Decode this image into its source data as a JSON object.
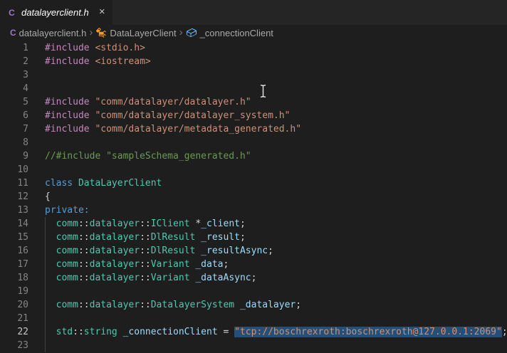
{
  "tab_bar": {
    "tabs": [
      {
        "icon": "c-file",
        "icon_letter": "C",
        "label": "datalayerclient.h",
        "close": "✕",
        "active": true,
        "preview": true
      }
    ]
  },
  "breadcrumb": {
    "separator": "›",
    "items": [
      {
        "icon": "c-file",
        "icon_letter": "C",
        "label": "datalayerclient.h"
      },
      {
        "icon": "symbol-class",
        "label": "DataLayerClient"
      },
      {
        "icon": "symbol-field",
        "label": "_connectionClient"
      }
    ]
  },
  "editor": {
    "language": "cpp",
    "active_line": 22,
    "lines": [
      {
        "num": "1",
        "tokens": [
          {
            "c": "macro",
            "t": "#include"
          },
          {
            "c": "pln",
            "t": " "
          },
          {
            "c": "str",
            "t": "<stdio.h>"
          }
        ]
      },
      {
        "num": "2",
        "tokens": [
          {
            "c": "macro",
            "t": "#include"
          },
          {
            "c": "pln",
            "t": " "
          },
          {
            "c": "str",
            "t": "<iostream>"
          }
        ]
      },
      {
        "num": "3",
        "tokens": []
      },
      {
        "num": "4",
        "tokens": []
      },
      {
        "num": "5",
        "tokens": [
          {
            "c": "macro",
            "t": "#include"
          },
          {
            "c": "pln",
            "t": " "
          },
          {
            "c": "str",
            "t": "\"comm/datalayer/datalayer.h\""
          }
        ]
      },
      {
        "num": "6",
        "tokens": [
          {
            "c": "macro",
            "t": "#include"
          },
          {
            "c": "pln",
            "t": " "
          },
          {
            "c": "str",
            "t": "\"comm/datalayer/datalayer_system.h\""
          }
        ]
      },
      {
        "num": "7",
        "tokens": [
          {
            "c": "macro",
            "t": "#include"
          },
          {
            "c": "pln",
            "t": " "
          },
          {
            "c": "str",
            "t": "\"comm/datalayer/metadata_generated.h\""
          }
        ]
      },
      {
        "num": "8",
        "tokens": []
      },
      {
        "num": "9",
        "tokens": [
          {
            "c": "cmt",
            "t": "//#include \"sampleSchema_generated.h\""
          }
        ]
      },
      {
        "num": "10",
        "tokens": []
      },
      {
        "num": "11",
        "tokens": [
          {
            "c": "kw",
            "t": "class"
          },
          {
            "c": "pln",
            "t": " "
          },
          {
            "c": "type",
            "t": "DataLayerClient"
          }
        ]
      },
      {
        "num": "12",
        "tokens": [
          {
            "c": "pln",
            "t": "{"
          }
        ]
      },
      {
        "num": "13",
        "tokens": [
          {
            "c": "kw",
            "t": "private:"
          }
        ]
      },
      {
        "num": "14",
        "guide": true,
        "tokens": [
          {
            "c": "pln",
            "t": "  "
          },
          {
            "c": "type",
            "t": "comm"
          },
          {
            "c": "pln",
            "t": "::"
          },
          {
            "c": "type",
            "t": "datalayer"
          },
          {
            "c": "pln",
            "t": "::"
          },
          {
            "c": "type",
            "t": "IClient"
          },
          {
            "c": "pln",
            "t": " *"
          },
          {
            "c": "var",
            "t": "_client"
          },
          {
            "c": "pln",
            "t": ";"
          }
        ]
      },
      {
        "num": "15",
        "guide": true,
        "tokens": [
          {
            "c": "pln",
            "t": "  "
          },
          {
            "c": "type",
            "t": "comm"
          },
          {
            "c": "pln",
            "t": "::"
          },
          {
            "c": "type",
            "t": "datalayer"
          },
          {
            "c": "pln",
            "t": "::"
          },
          {
            "c": "type",
            "t": "DlResult"
          },
          {
            "c": "pln",
            "t": " "
          },
          {
            "c": "var",
            "t": "_result"
          },
          {
            "c": "pln",
            "t": ";"
          }
        ]
      },
      {
        "num": "16",
        "guide": true,
        "tokens": [
          {
            "c": "pln",
            "t": "  "
          },
          {
            "c": "type",
            "t": "comm"
          },
          {
            "c": "pln",
            "t": "::"
          },
          {
            "c": "type",
            "t": "datalayer"
          },
          {
            "c": "pln",
            "t": "::"
          },
          {
            "c": "type",
            "t": "DlResult"
          },
          {
            "c": "pln",
            "t": " "
          },
          {
            "c": "var",
            "t": "_resultAsync"
          },
          {
            "c": "pln",
            "t": ";"
          }
        ]
      },
      {
        "num": "17",
        "guide": true,
        "tokens": [
          {
            "c": "pln",
            "t": "  "
          },
          {
            "c": "type",
            "t": "comm"
          },
          {
            "c": "pln",
            "t": "::"
          },
          {
            "c": "type",
            "t": "datalayer"
          },
          {
            "c": "pln",
            "t": "::"
          },
          {
            "c": "type",
            "t": "Variant"
          },
          {
            "c": "pln",
            "t": " "
          },
          {
            "c": "var",
            "t": "_data"
          },
          {
            "c": "pln",
            "t": ";"
          }
        ]
      },
      {
        "num": "18",
        "guide": true,
        "tokens": [
          {
            "c": "pln",
            "t": "  "
          },
          {
            "c": "type",
            "t": "comm"
          },
          {
            "c": "pln",
            "t": "::"
          },
          {
            "c": "type",
            "t": "datalayer"
          },
          {
            "c": "pln",
            "t": "::"
          },
          {
            "c": "type",
            "t": "Variant"
          },
          {
            "c": "pln",
            "t": " "
          },
          {
            "c": "var",
            "t": "_dataAsync"
          },
          {
            "c": "pln",
            "t": ";"
          }
        ]
      },
      {
        "num": "19",
        "guide": true,
        "tokens": []
      },
      {
        "num": "20",
        "guide": true,
        "tokens": [
          {
            "c": "pln",
            "t": "  "
          },
          {
            "c": "type",
            "t": "comm"
          },
          {
            "c": "pln",
            "t": "::"
          },
          {
            "c": "type",
            "t": "datalayer"
          },
          {
            "c": "pln",
            "t": "::"
          },
          {
            "c": "type",
            "t": "DatalayerSystem"
          },
          {
            "c": "pln",
            "t": " "
          },
          {
            "c": "var",
            "t": "_datalayer"
          },
          {
            "c": "pln",
            "t": ";"
          }
        ]
      },
      {
        "num": "21",
        "guide": true,
        "tokens": []
      },
      {
        "num": "22",
        "guide": true,
        "active": true,
        "tokens": [
          {
            "c": "pln",
            "t": "  "
          },
          {
            "c": "type",
            "t": "std"
          },
          {
            "c": "pln",
            "t": "::"
          },
          {
            "c": "type",
            "t": "string"
          },
          {
            "c": "pln",
            "t": " "
          },
          {
            "c": "var",
            "t": "_connectionClient"
          },
          {
            "c": "pln",
            "t": " = "
          },
          {
            "c": "sel",
            "t": "\"tcp://boschrexroth:boschrexroth@127.0.0.1:2069\""
          },
          {
            "c": "pln",
            "t": ";"
          },
          {
            "c": "cursor",
            "t": ""
          }
        ]
      },
      {
        "num": "23",
        "guide": true,
        "tokens": []
      }
    ]
  },
  "colors": {
    "editor_bg": "#1E1E1E",
    "tabbar_bg": "#252526",
    "tab_fg": "#FFFFFF",
    "selection": "#264F78",
    "keyword": "#569CD6",
    "type": "#4EC9B0",
    "variable": "#9CDCFE",
    "string": "#CE9178",
    "macro": "#C586C0",
    "comment": "#6A9955",
    "punctuation": "#D4D4D4",
    "line_number": "#858585",
    "line_number_active": "#C6C6C6",
    "breadcrumb_fg": "#A9A9A9",
    "class_icon": "#EE9D28",
    "field_icon": "#75BEFF",
    "c_icon": "#A074C8",
    "guide": "#404040",
    "cursor": "#D7D7D7"
  }
}
